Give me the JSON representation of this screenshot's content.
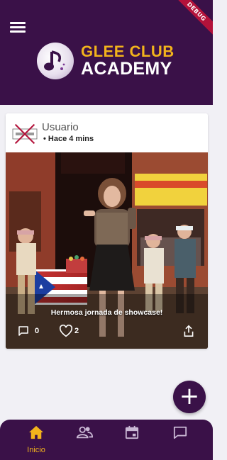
{
  "app": {
    "debug_badge": "DEBUG",
    "logo_line1": "GLEE CLUB",
    "logo_line2": "ACADEMY"
  },
  "post": {
    "user_name": "Usuario",
    "time": "• Hace 4 mins",
    "caption": "Hermosa jornada de showcase!",
    "comments_count": "0",
    "likes_count": "2",
    "icons": [
      "comment-icon",
      "heart-icon",
      "share-icon"
    ]
  },
  "nav": {
    "items": [
      {
        "label": "Inicio",
        "icon": "home-icon",
        "active": true
      },
      {
        "label": "",
        "icon": "people-icon",
        "active": false
      },
      {
        "label": "",
        "icon": "calendar-icon",
        "active": false
      },
      {
        "label": "",
        "icon": "chat-icon",
        "active": false
      }
    ]
  },
  "fab": {
    "icon": "plus-icon",
    "label": "+"
  },
  "colors": {
    "primary": "#3a1148",
    "accent": "#f2b31c",
    "background": "#f1f0f5",
    "debug": "#b3123a"
  }
}
